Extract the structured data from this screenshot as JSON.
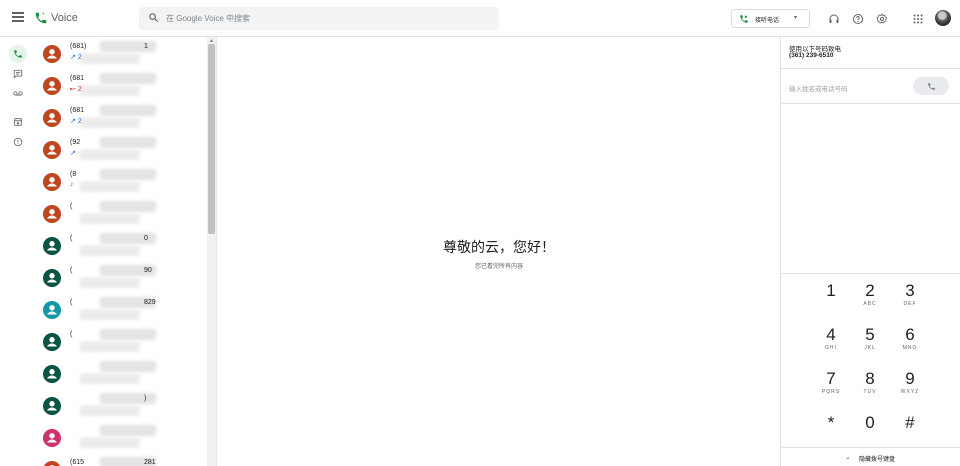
{
  "header": {
    "app_title": "Voice",
    "search_placeholder": "在 Google Voice 中搜索",
    "call_mode_label": "接听电话",
    "call_mode_caret": "▾"
  },
  "conversations": [
    {
      "number": "(681)",
      "number_tail": "1",
      "sub": "↗ 2",
      "type": "outgoing",
      "color": "#c0461f"
    },
    {
      "number": "(681",
      "number_tail": "",
      "sub": "↜ 2",
      "type": "missed",
      "color": "#c0461f"
    },
    {
      "number": "(681",
      "number_tail": "",
      "sub": "↗ 2",
      "type": "outgoing",
      "color": "#c0461f"
    },
    {
      "number": "(92",
      "number_tail": "",
      "sub": "↗",
      "type": "outgoing",
      "color": "#c0461f"
    },
    {
      "number": "(8",
      "number_tail": "",
      "sub": "♪",
      "type": "voicemail",
      "color": "#c0461f"
    },
    {
      "number": "(",
      "number_tail": "",
      "sub": "",
      "type": "",
      "color": "#c0461f"
    },
    {
      "number": "(",
      "number_tail": "0",
      "sub": "",
      "type": "",
      "color": "#0b5344"
    },
    {
      "number": "(",
      "number_tail": "90",
      "sub": "",
      "type": "",
      "color": "#0b5344"
    },
    {
      "number": "(",
      "number_tail": "829",
      "sub": "",
      "type": "",
      "color": "#1397a8"
    },
    {
      "number": "(",
      "number_tail": "",
      "sub": "",
      "type": "",
      "color": "#0b5344"
    },
    {
      "number": "",
      "number_tail": "",
      "sub": "",
      "type": "",
      "color": "#0b5344"
    },
    {
      "number": "",
      "number_tail": ")",
      "sub": "",
      "type": "",
      "color": "#0b5344"
    },
    {
      "number": "",
      "number_tail": "",
      "sub": "",
      "type": "",
      "color": "#d0306c"
    },
    {
      "number": "(615",
      "number_tail": "281",
      "sub": "",
      "type": "",
      "color": "#c0461f"
    }
  ],
  "main": {
    "greeting": "尊敬的云，您好！",
    "subtitle": "您已看完所有内容"
  },
  "dialer": {
    "using_label": "使用以下号码致电",
    "using_number": "(361) 239-6510",
    "input_placeholder": "输入姓名或电话号码",
    "keys": [
      {
        "digit": "1",
        "letters": ""
      },
      {
        "digit": "2",
        "letters": "ABC"
      },
      {
        "digit": "3",
        "letters": "DEF"
      },
      {
        "digit": "4",
        "letters": "GHI"
      },
      {
        "digit": "5",
        "letters": "JKL"
      },
      {
        "digit": "6",
        "letters": "MNO"
      },
      {
        "digit": "7",
        "letters": "PQRS"
      },
      {
        "digit": "8",
        "letters": "TUV"
      },
      {
        "digit": "9",
        "letters": "WXYZ"
      },
      {
        "digit": "*",
        "letters": ""
      },
      {
        "digit": "0",
        "letters": ""
      },
      {
        "digit": "#",
        "letters": ""
      }
    ],
    "hide_label": "隐藏拨号键盘"
  },
  "colors": {
    "accent_green": "#1e8e3e",
    "active_rail_bg": "#e6f4ea"
  },
  "icons": {
    "rail": [
      "calls-icon",
      "messages-icon",
      "voicemail-icon",
      "archive-icon",
      "spam-icon"
    ],
    "header": [
      "headset-icon",
      "help-icon",
      "settings-icon",
      "apps-icon"
    ]
  }
}
